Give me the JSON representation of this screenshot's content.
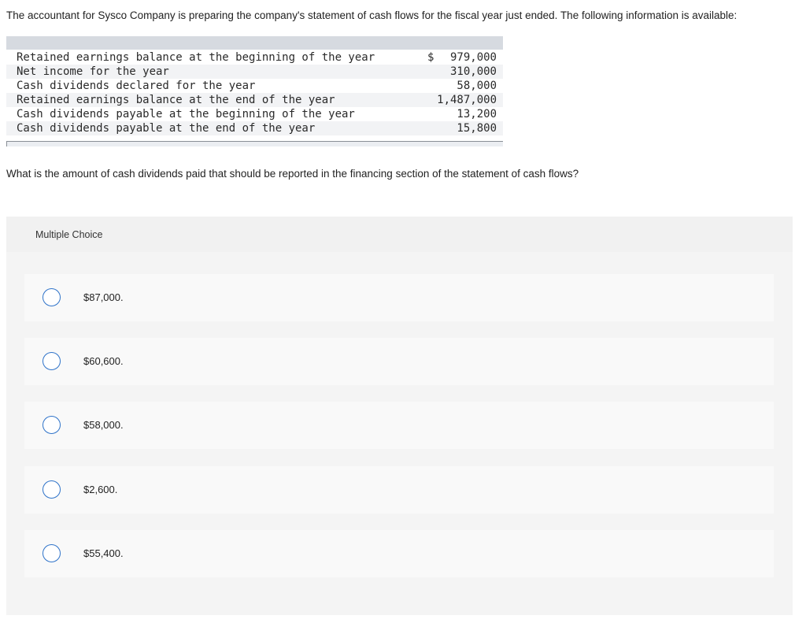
{
  "intro": "The accountant for Sysco Company is preparing the company's statement of cash flows for the fiscal year just ended. The following information is available:",
  "table": {
    "rows": [
      {
        "label": "Retained earnings balance at the beginning of the year",
        "dollar": "$",
        "amount": "979,000"
      },
      {
        "label": "Net income for the year",
        "dollar": "",
        "amount": "310,000"
      },
      {
        "label": "Cash dividends declared for the year",
        "dollar": "",
        "amount": "58,000"
      },
      {
        "label": "Retained earnings balance at the end of the year",
        "dollar": "",
        "amount": "1,487,000"
      },
      {
        "label": "Cash dividends payable at the beginning of the year",
        "dollar": "",
        "amount": "13,200"
      },
      {
        "label": "Cash dividends payable at the end of the year",
        "dollar": "",
        "amount": "15,800"
      }
    ]
  },
  "question": "What is the amount of cash dividends paid that should be reported in the financing section of the statement of cash flows?",
  "multiple_choice": {
    "title": "Multiple Choice",
    "options": [
      {
        "label": "$87,000."
      },
      {
        "label": "$60,600."
      },
      {
        "label": "$58,000."
      },
      {
        "label": "$2,600."
      },
      {
        "label": "$55,400."
      }
    ]
  },
  "colors": {
    "radio_border": "#2f73c9",
    "table_header": "#d6dae0",
    "panel_bg": "#f5f5f5"
  }
}
